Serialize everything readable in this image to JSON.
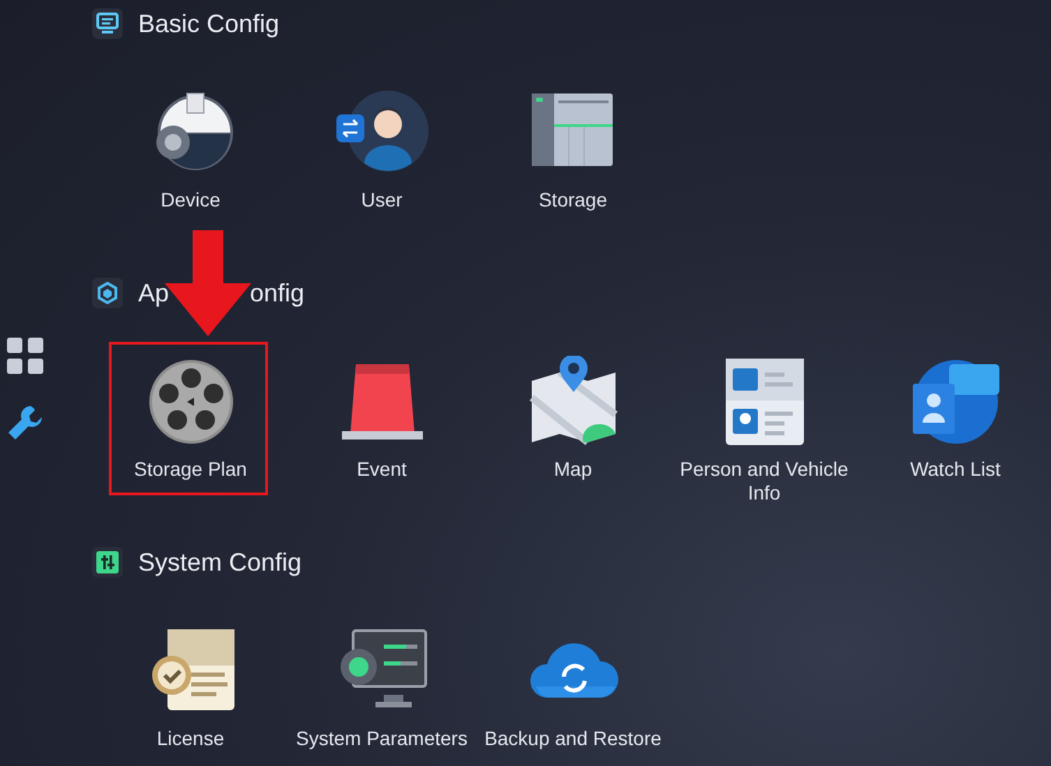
{
  "sidebar": {
    "items": [
      {
        "kind": "grid",
        "selected": false
      },
      {
        "kind": "wrench",
        "selected": true
      }
    ]
  },
  "sections": [
    {
      "kind": "monitor",
      "title_parts": [
        "Basic Config"
      ],
      "tiles": [
        {
          "kind": "device",
          "label": "Device",
          "highlighted": false
        },
        {
          "kind": "user",
          "label": "User",
          "highlighted": false
        },
        {
          "kind": "storage",
          "label": "Storage",
          "highlighted": false
        }
      ]
    },
    {
      "kind": "cube",
      "title_parts": [
        "Ap",
        "onfig"
      ],
      "tiles": [
        {
          "kind": "reel",
          "label": "Storage Plan",
          "highlighted": true
        },
        {
          "kind": "alarm",
          "label": "Event",
          "highlighted": false
        },
        {
          "kind": "map",
          "label": "Map",
          "highlighted": false
        },
        {
          "kind": "card",
          "label": "Person and Vehicle Info",
          "highlighted": false
        },
        {
          "kind": "watchlist",
          "label": "Watch List",
          "highlighted": false
        }
      ]
    },
    {
      "kind": "sliders",
      "title_parts": [
        "System Config"
      ],
      "tiles": [
        {
          "kind": "license",
          "label": "License",
          "highlighted": false
        },
        {
          "kind": "settings",
          "label": "System Parameters",
          "highlighted": false
        },
        {
          "kind": "cloud",
          "label": "Backup and Restore",
          "highlighted": false
        }
      ]
    }
  ],
  "annotation": {
    "kind": "arrow"
  }
}
